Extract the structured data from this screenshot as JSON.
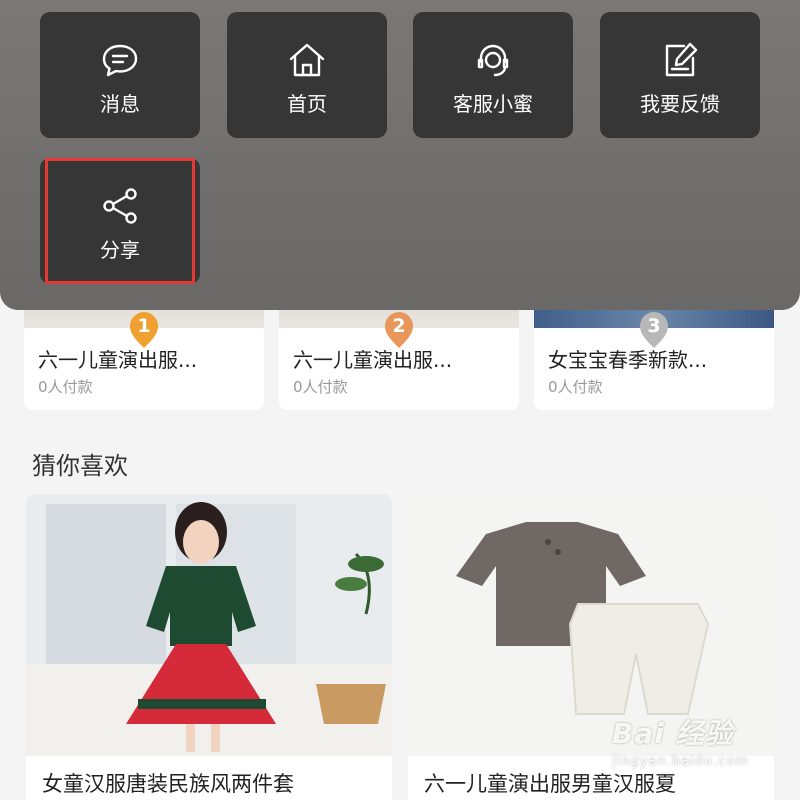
{
  "menu": {
    "items": [
      {
        "label": "消息",
        "icon": "message-icon"
      },
      {
        "label": "首页",
        "icon": "home-icon"
      },
      {
        "label": "客服小蜜",
        "icon": "customer-service-icon"
      },
      {
        "label": "我要反馈",
        "icon": "feedback-icon"
      },
      {
        "label": "分享",
        "icon": "share-icon"
      }
    ],
    "highlight_color": "#e53935",
    "tile_color": "#363636"
  },
  "ranking": {
    "items": [
      {
        "rank": "1",
        "title": "六一儿童演出服...",
        "paid": "0人付款",
        "medal_color": "#f0a030"
      },
      {
        "rank": "2",
        "title": "六一儿童演出服...",
        "paid": "0人付款",
        "medal_color": "#e8965a"
      },
      {
        "rank": "3",
        "title": "女宝宝春季新款...",
        "paid": "0人付款",
        "medal_color": "#b8b8b8"
      }
    ]
  },
  "recommend": {
    "title": "猜你喜欢",
    "products": [
      {
        "title": "女童汉服唐装民族风两件套"
      },
      {
        "title": "六一儿童演出服男童汉服夏"
      }
    ]
  },
  "watermark": {
    "brand": "Bai 经验",
    "url": "jingyan.baidu.com"
  }
}
